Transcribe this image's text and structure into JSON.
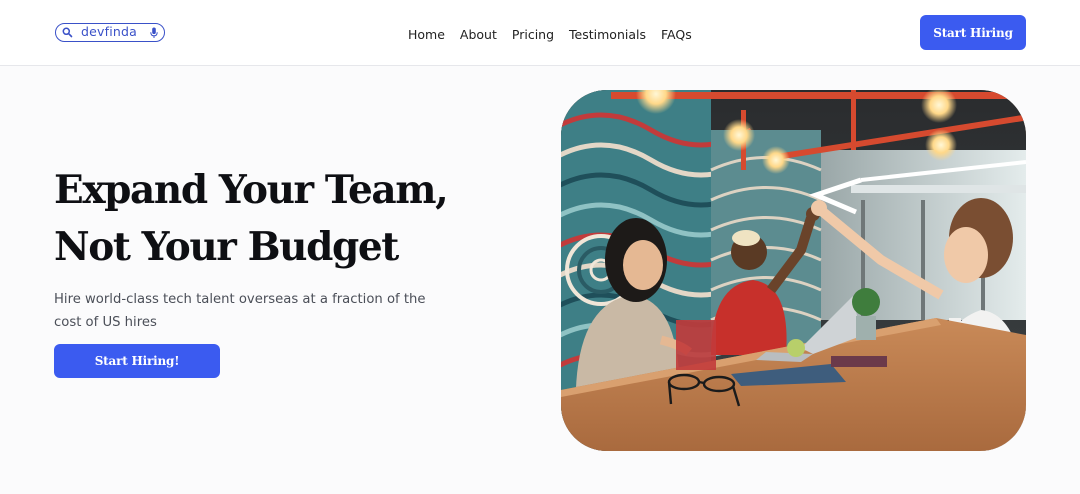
{
  "brand": {
    "name": "devfinda"
  },
  "nav": {
    "items": [
      {
        "label": "Home"
      },
      {
        "label": "About"
      },
      {
        "label": "Pricing"
      },
      {
        "label": "Testimonials"
      },
      {
        "label": "FAQs"
      }
    ]
  },
  "header": {
    "cta_label": "Start Hiring"
  },
  "hero": {
    "title_line1": "Expand Your Team,",
    "title_line2": "Not Your Budget",
    "subtitle": "Hire world-class tech talent overseas at a fraction of the cost of US hires",
    "cta_label": "Start Hiring!"
  },
  "colors": {
    "accent": "#3b5bf0",
    "logo": "#3a51c8",
    "heading": "#0e0f13",
    "body_text": "#4b4f58"
  },
  "icons": {
    "logo_left": "search-icon",
    "logo_right": "microphone-icon"
  }
}
